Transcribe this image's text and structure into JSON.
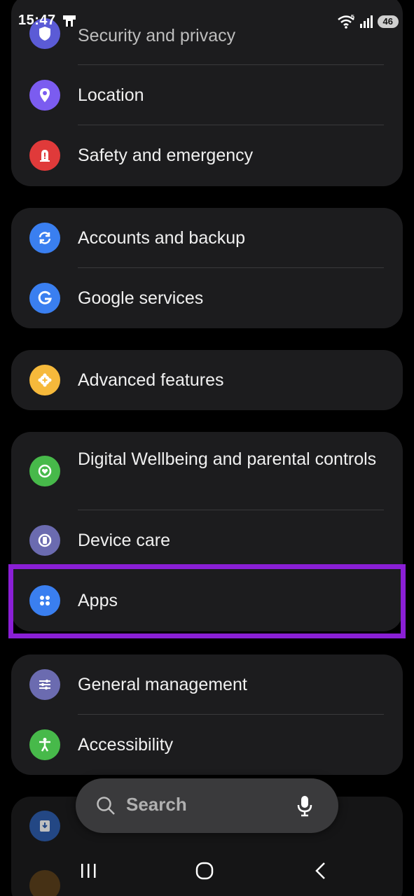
{
  "status_bar": {
    "time": "15:47",
    "battery": "46",
    "signal": "5"
  },
  "settings": [
    {
      "label": "Security and privacy",
      "icon": "shield-icon",
      "color": "#5b5bd6"
    },
    {
      "label": "Location",
      "icon": "location-pin-icon",
      "color": "#7b5cf0"
    },
    {
      "label": "Safety and emergency",
      "icon": "alert-icon",
      "color": "#e03a3a"
    },
    {
      "label": "Accounts and backup",
      "icon": "sync-icon",
      "color": "#3a7ff0"
    },
    {
      "label": "Google services",
      "icon": "google-icon",
      "color": "#3a7ff0"
    },
    {
      "label": "Advanced features",
      "icon": "gear-plus-icon",
      "color": "#f6b93b"
    },
    {
      "label": "Digital Wellbeing and parental controls",
      "icon": "heart-ring-icon",
      "color": "#47b94a"
    },
    {
      "label": "Device care",
      "icon": "device-care-icon",
      "color": "#6b6bb0"
    },
    {
      "label": "Apps",
      "icon": "apps-grid-icon",
      "color": "#3a7ff0"
    },
    {
      "label": "General management",
      "icon": "sliders-icon",
      "color": "#6b6bb0"
    },
    {
      "label": "Accessibility",
      "icon": "accessibility-icon",
      "color": "#47b94a"
    }
  ],
  "search": {
    "placeholder": "Search"
  },
  "highlight_color": "#8a1fd6"
}
